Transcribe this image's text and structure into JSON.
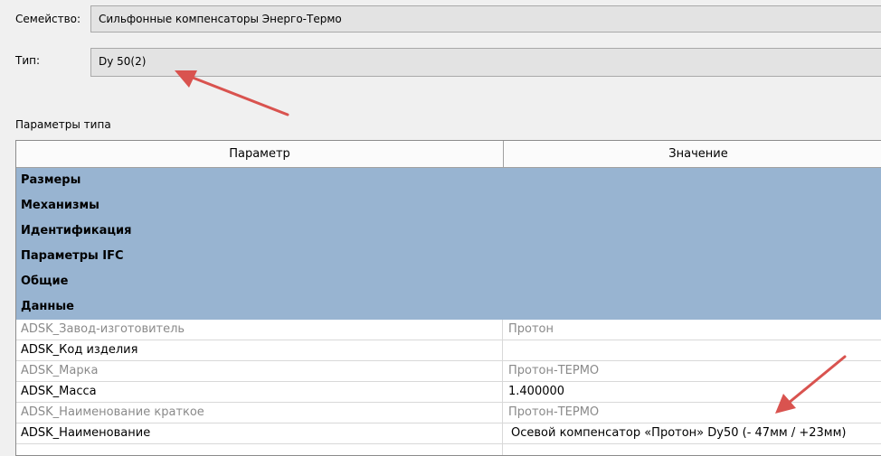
{
  "family": {
    "label": "Семейство:",
    "value": "Сильфонные компенсаторы Энерго-Термо"
  },
  "type": {
    "label": "Тип:",
    "value": "Dy 50(2)"
  },
  "section_label": "Параметры типа",
  "table": {
    "headers": {
      "param": "Параметр",
      "value": "Значение"
    },
    "groups": [
      "Размеры",
      "Механизмы",
      "Идентификация",
      "Параметры IFC",
      "Общие",
      "Данные"
    ],
    "rows": [
      {
        "param": "ADSK_Завод-изготовитель",
        "value": "Протон"
      },
      {
        "param": "ADSK_Код изделия",
        "value": ""
      },
      {
        "param": "ADSK_Марка",
        "value": "Протон-ТЕРМО"
      },
      {
        "param": "ADSK_Масса",
        "value": "1.400000"
      },
      {
        "param": "ADSK_Наименование краткое",
        "value": "Протон-ТЕРМО"
      },
      {
        "param": "ADSK_Наименование",
        "value": "Осевой компенсатор «Протон» Dy50 (- 47мм / +23мм)"
      }
    ]
  },
  "annotation_color": "#d9534f"
}
